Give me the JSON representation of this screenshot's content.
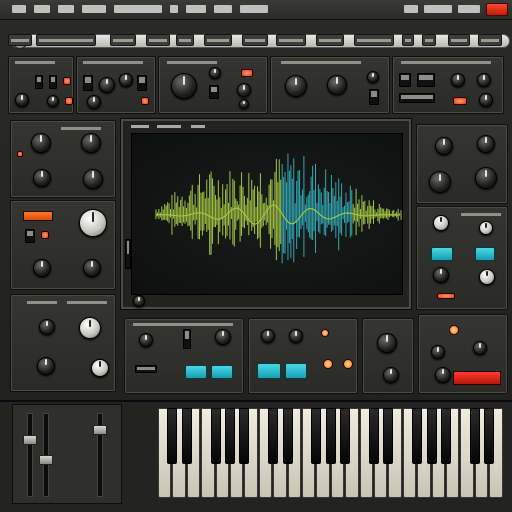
{
  "app": {
    "title": ""
  },
  "colors": {
    "panel": "#2f2f2c",
    "accent_red": "#e23b10",
    "accent_cyan": "#2bc0d0",
    "waveform_green": "#a3c542",
    "waveform_teal": "#2fa8b4",
    "key_white": "#e6e2d3"
  },
  "top_menu": {
    "record_button_icon": "record-icon",
    "menu_item_count": 12
  },
  "waveform_display": {
    "style": "oscilloscope",
    "colors": [
      "#a3c542",
      "#2fa8b4"
    ]
  },
  "icons": [
    "knob-icon",
    "led-icon",
    "toggle-switch-icon",
    "fader-icon",
    "piano-key-icon"
  ]
}
